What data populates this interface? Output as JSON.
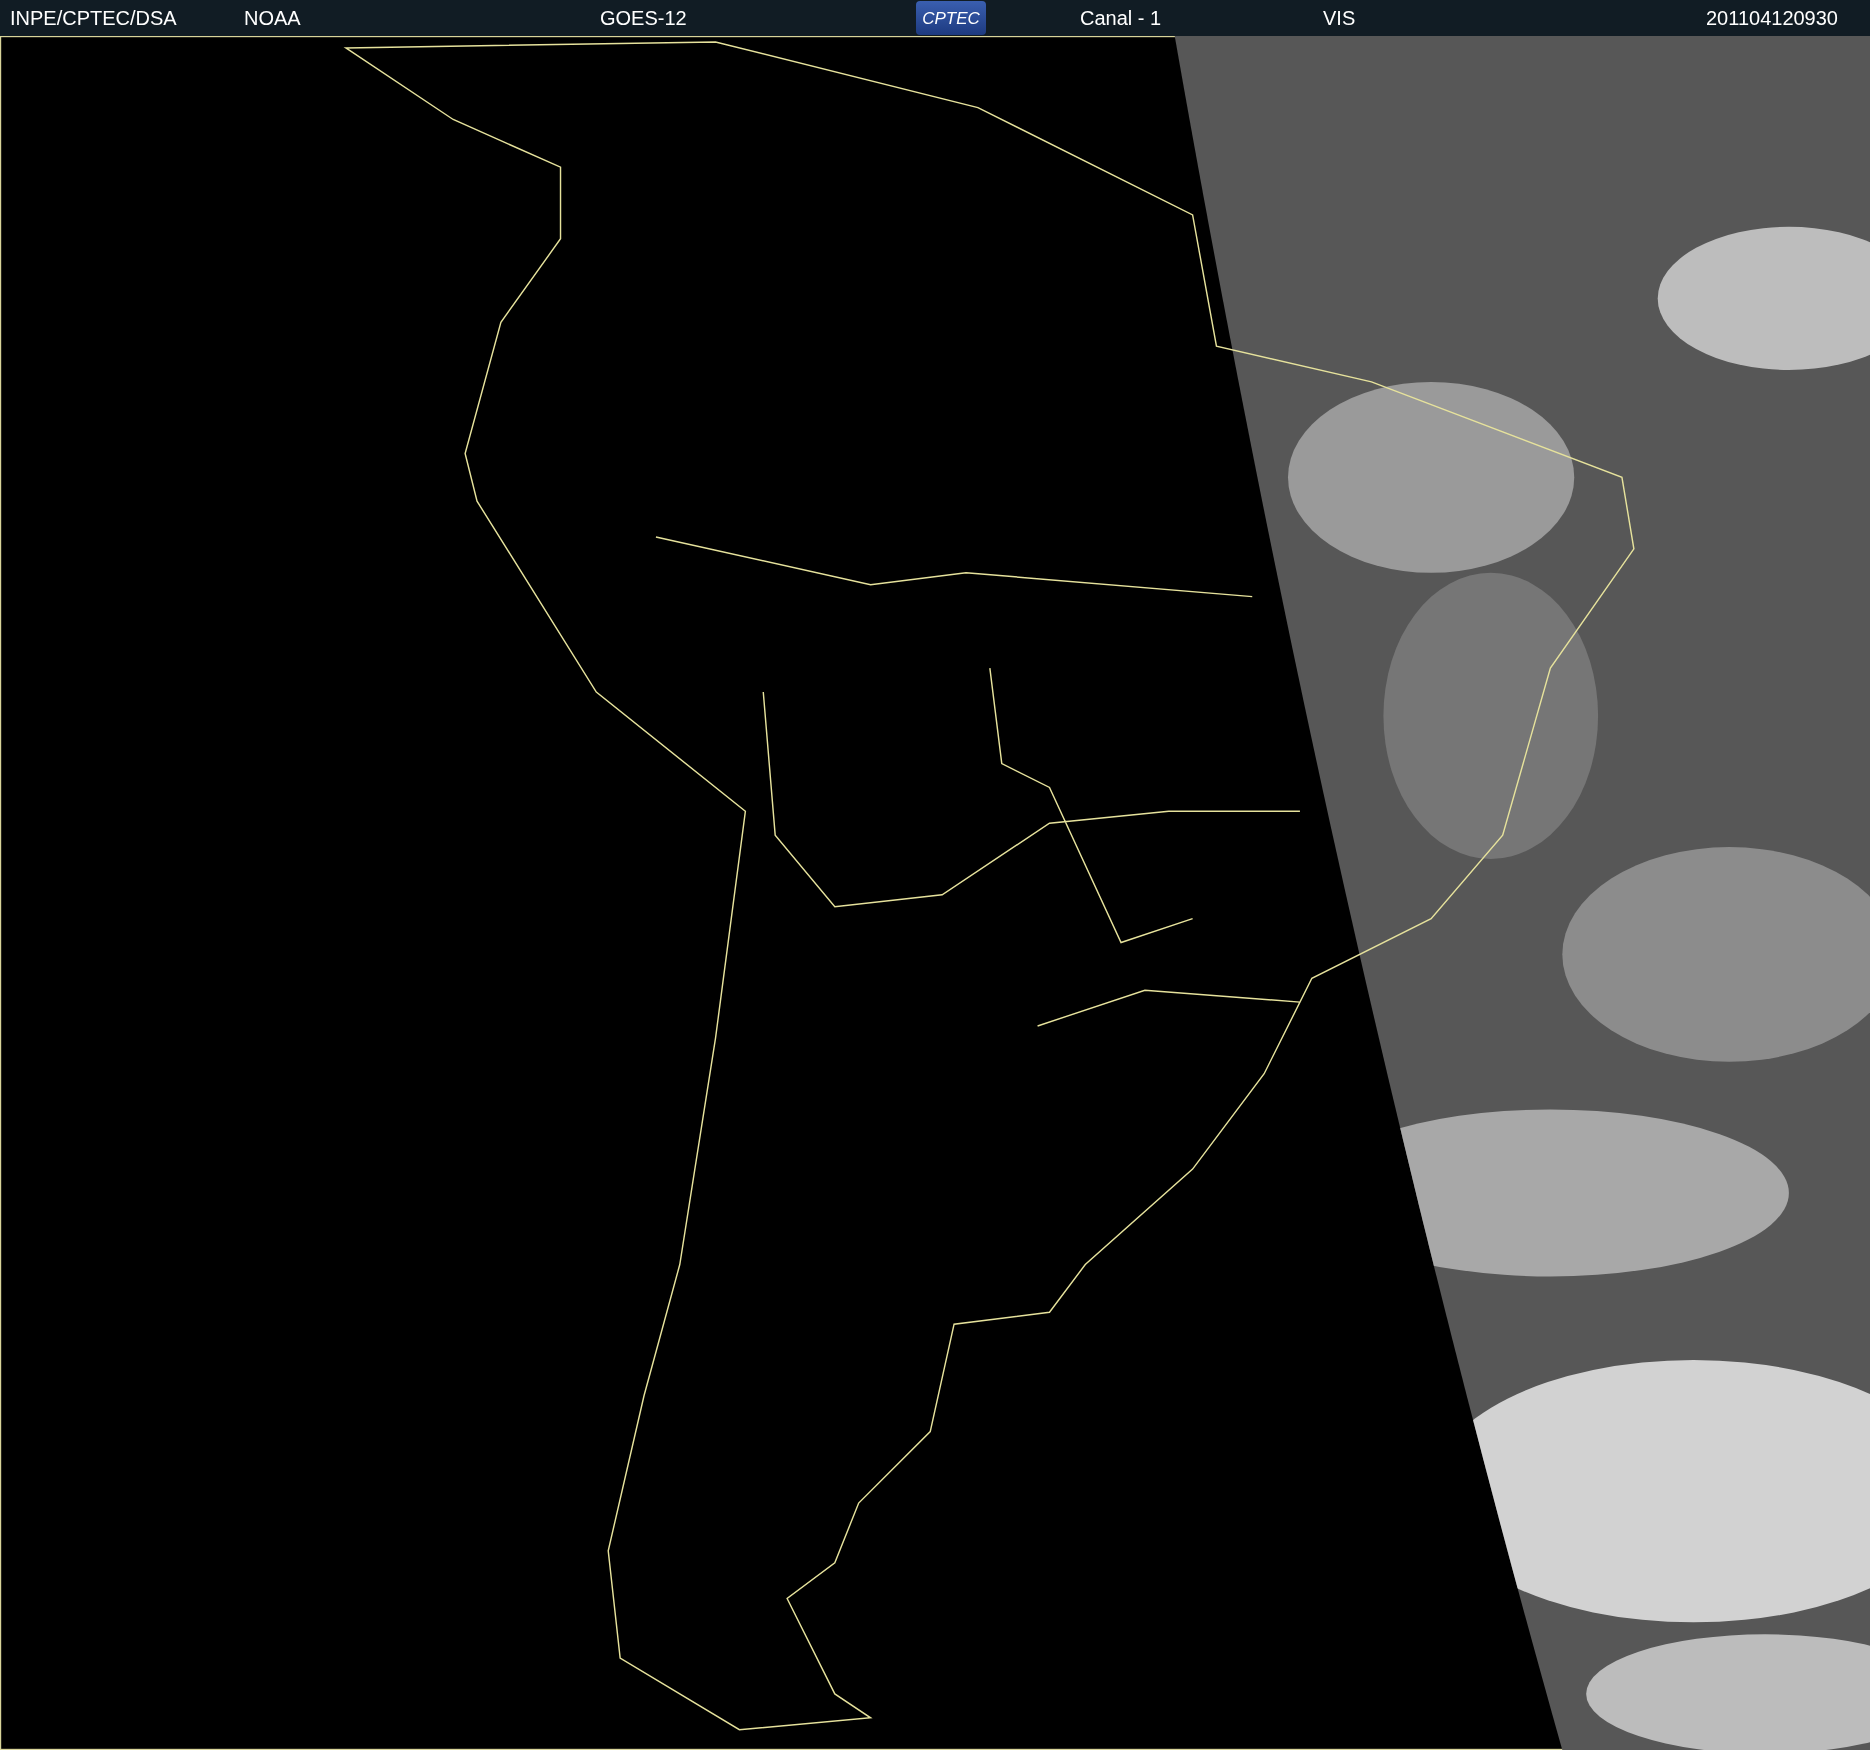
{
  "header": {
    "source": "INPE/CPTEC/DSA",
    "agency": "NOAA",
    "satellite": "GOES-12",
    "logo": "CPTEC",
    "channel": "Canal - 1",
    "band": "VIS",
    "timestamp": "201104120930"
  }
}
